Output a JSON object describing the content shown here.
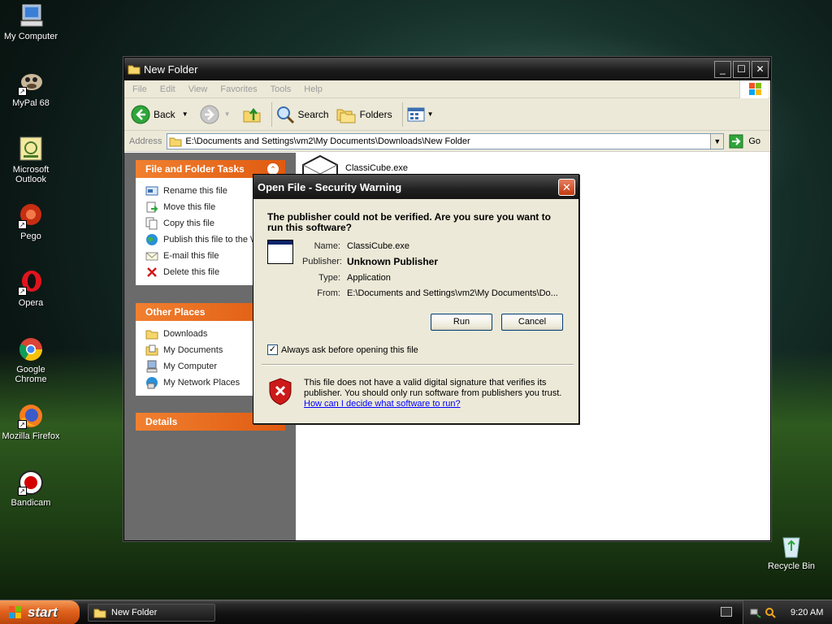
{
  "desktop": {
    "icons": [
      {
        "label": "My Computer"
      },
      {
        "label": "MyPal 68"
      },
      {
        "label": "Microsoft Outlook"
      },
      {
        "label": "Pego"
      },
      {
        "label": "Opera"
      },
      {
        "label": "Google Chrome"
      },
      {
        "label": "Mozilla Firefox"
      },
      {
        "label": "Bandicam"
      }
    ],
    "recycle_bin": "Recycle Bin"
  },
  "explorer": {
    "title": "New Folder",
    "menu": [
      "File",
      "Edit",
      "View",
      "Favorites",
      "Tools",
      "Help"
    ],
    "toolbar": {
      "back": "Back",
      "search": "Search",
      "folders": "Folders"
    },
    "address": {
      "label": "Address",
      "value": "E:\\Documents and Settings\\vm2\\My Documents\\Downloads\\New Folder",
      "go": "Go"
    },
    "file_tasks": {
      "header": "File and Folder Tasks",
      "items": [
        "Rename this file",
        "Move this file",
        "Copy this file",
        "Publish this file to the Web",
        "E-mail this file",
        "Delete this file"
      ]
    },
    "other_places": {
      "header": "Other Places",
      "items": [
        "Downloads",
        "My Documents",
        "My Computer",
        "My Network Places"
      ]
    },
    "details": {
      "header": "Details"
    },
    "file": {
      "name": "ClassiCube.exe"
    }
  },
  "dialog": {
    "title": "Open File - Security Warning",
    "question": "The publisher could not be verified.  Are you sure you want to run this software?",
    "fields": {
      "name_label": "Name:",
      "name": "ClassiCube.exe",
      "publisher_label": "Publisher:",
      "publisher": "Unknown Publisher",
      "type_label": "Type:",
      "type": "Application",
      "from_label": "From:",
      "from": "E:\\Documents and Settings\\vm2\\My Documents\\Do..."
    },
    "run": "Run",
    "cancel": "Cancel",
    "always_ask": "Always ask before opening this file",
    "always_ask_checked": true,
    "warning": "This file does not have a valid digital signature that verifies its publisher.  You should only run software from publishers you trust.",
    "link": "How can I decide what software to run?"
  },
  "taskbar": {
    "start": "start",
    "task": "New Folder",
    "clock": "9:20 AM"
  },
  "colors": {
    "panel_header": "#e05a10",
    "link": "#0000ff",
    "titlebar": "#1c1c1c"
  }
}
